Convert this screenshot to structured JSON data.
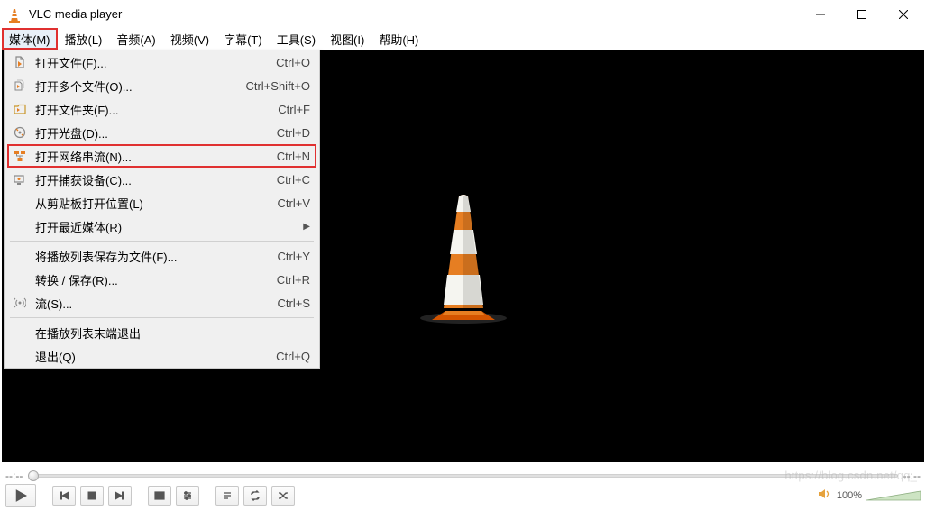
{
  "window": {
    "title": "VLC media player"
  },
  "menubar": [
    {
      "label": "媒体(M)",
      "active": true
    },
    {
      "label": "播放(L)"
    },
    {
      "label": "音频(A)"
    },
    {
      "label": "视频(V)"
    },
    {
      "label": "字幕(T)"
    },
    {
      "label": "工具(S)"
    },
    {
      "label": "视图(I)"
    },
    {
      "label": "帮助(H)"
    }
  ],
  "dropdown": [
    {
      "icon": "file",
      "label": "打开文件(F)...",
      "shortcut": "Ctrl+O"
    },
    {
      "icon": "files",
      "label": "打开多个文件(O)...",
      "shortcut": "Ctrl+Shift+O"
    },
    {
      "icon": "folder",
      "label": "打开文件夹(F)...",
      "shortcut": "Ctrl+F"
    },
    {
      "icon": "disc",
      "label": "打开光盘(D)...",
      "shortcut": "Ctrl+D"
    },
    {
      "icon": "network",
      "label": "打开网络串流(N)...",
      "shortcut": "Ctrl+N",
      "highlighted": true
    },
    {
      "icon": "capture",
      "label": "打开捕获设备(C)...",
      "shortcut": "Ctrl+C"
    },
    {
      "icon": "",
      "label": "从剪贴板打开位置(L)",
      "shortcut": "Ctrl+V"
    },
    {
      "icon": "",
      "label": "打开最近媒体(R)",
      "shortcut": "",
      "submenu": true
    },
    {
      "sep": true
    },
    {
      "icon": "",
      "label": "将播放列表保存为文件(F)...",
      "shortcut": "Ctrl+Y"
    },
    {
      "icon": "",
      "label": "转换 / 保存(R)...",
      "shortcut": "Ctrl+R"
    },
    {
      "icon": "stream",
      "label": "流(S)...",
      "shortcut": "Ctrl+S"
    },
    {
      "sep": true
    },
    {
      "icon": "",
      "label": "在播放列表末端退出",
      "shortcut": ""
    },
    {
      "icon": "",
      "label": "退出(Q)",
      "shortcut": "Ctrl+Q"
    }
  ],
  "time": {
    "left": "--:--",
    "right": "--:--"
  },
  "volume": {
    "text": "100%"
  },
  "watermark": "https://blog.csdn.net/qq_"
}
